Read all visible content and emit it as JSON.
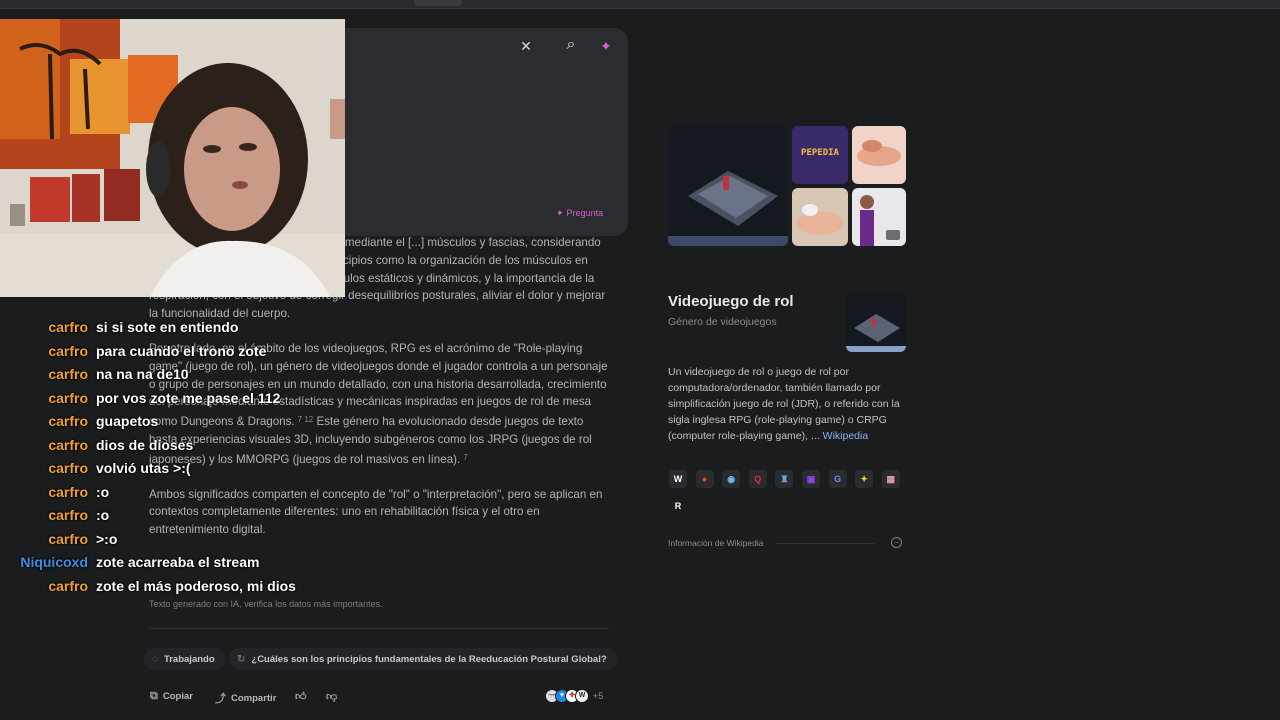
{
  "search_card": {
    "close_icon": "✕",
    "search_icon": "⌕",
    "ai_icon": "✦",
    "ask_label": "Pregunta"
  },
  "answer": {
    "p1": "[...] posturales y musculoesqueléticos mediante el [...] músculos y fascias, considerando al cuerpo [...] La RPG se basa en principios como la organización de los músculos en cadenas, la diferenciación entre músculos estáticos y dinámicos, y la importancia de la respiración, con el objetivo de corregir desequilibrios posturales, aliviar el dolor y mejorar la funcionalidad del cuerpo.",
    "p2a": "Por otro lado, en el ámbito de los videojuegos, RPG es el acrónimo de \"Role-playing game\" (juego de rol), un género de videojuegos donde el jugador controla a un personaje o grupo de personajes en un mundo detallado, con una historia desarrollada, crecimiento del personaje mediante estadísticas y mecánicas inspiradas en juegos de rol de mesa como Dungeons & Dragons.",
    "p2a_cite": "7 12",
    "p2b": "Este género ha evolucionado desde juegos de texto hasta experiencias visuales 3D, incluyendo subgéneros como los JRPG (juegos de rol japoneses) y los MMORPG (juegos de rol masivos en línea).",
    "p2b_cite": "7",
    "p3": "Ambos significados comparten el concepto de \"rol\" o \"interpretación\", pero se aplican en contextos completamente diferentes: uno en rehabilitación física y el otro en entretenimiento digital.",
    "disclaimer": "Texto generado con IA, verifica los datos más importantes."
  },
  "chips": {
    "working": "Trabajando",
    "suggestion": "¿Cuáles son los principios fundamentales de la Reeducación Postural Global?"
  },
  "actions": {
    "copy": "Copiar",
    "share": "Compartir",
    "sources_more": "+5"
  },
  "chat": [
    {
      "user": "carfro",
      "color": "#f0a030",
      "msg": "si si sote en entiendo"
    },
    {
      "user": "carfro",
      "color": "#f0a030",
      "msg": "para cuando el trono zote"
    },
    {
      "user": "carfro",
      "color": "#f0a030",
      "msg": "na na na de10"
    },
    {
      "user": "carfro",
      "color": "#f0a030",
      "msg": "por vos zote me pase el 112"
    },
    {
      "user": "carfro",
      "color": "#f0a030",
      "msg": "guapetos"
    },
    {
      "user": "carfro",
      "color": "#f0a030",
      "msg": "dios de dioses"
    },
    {
      "user": "carfro",
      "color": "#f0a030",
      "msg": "volvió utas >:("
    },
    {
      "user": "carfro",
      "color": "#f0a030",
      "msg": ":o"
    },
    {
      "user": "carfro",
      "color": "#f0a030",
      "msg": ":o"
    },
    {
      "user": "carfro",
      "color": "#f0a030",
      "msg": ">:o"
    },
    {
      "user": "Niquicoxd",
      "color": "#3f8fe0",
      "msg": "zote acarreaba el stream"
    },
    {
      "user": "carfro",
      "color": "#f0a030",
      "msg": "zote el más poderoso, mi dios"
    }
  ],
  "knowledge_panel": {
    "title": "Videojuego de rol",
    "subtitle": "Género de videojuegos",
    "description": "Un videojuego de rol o juego de rol por computadora/ordenador, también llamado por simplificación juego de rol (JDR), o referido con la sigla inglesa RPG (role-playing game) o CRPG (computer role-playing game), ...",
    "wiki_link": "Wikipedia",
    "pepedia_text": "PEPEDIA",
    "footer": "Información de Wikipedia",
    "socials": [
      {
        "name": "wikipedia-icon",
        "glyph": "W",
        "color": "#ffffff",
        "bg": "#2a2b2f"
      },
      {
        "name": "reddit-icon",
        "glyph": "●",
        "color": "#ff4500",
        "bg": "#2a2b2f"
      },
      {
        "name": "steam-icon",
        "glyph": "◉",
        "color": "#66c0f4",
        "bg": "#2a2b2f"
      },
      {
        "name": "rpg-icon",
        "glyph": "Q",
        "color": "#e03030",
        "bg": "#2a2b2f"
      },
      {
        "name": "fandom-icon",
        "glyph": "♜",
        "color": "#6aa6d8",
        "bg": "#2a2b2f"
      },
      {
        "name": "twitch-icon",
        "glyph": "▣",
        "color": "#9146ff",
        "bg": "#2a2b2f"
      },
      {
        "name": "gamespot-icon",
        "glyph": "G",
        "color": "#6d8cff",
        "bg": "#2a2b2f"
      },
      {
        "name": "star-icon",
        "glyph": "✦",
        "color": "#f0d020",
        "bg": "#2a2b2f"
      },
      {
        "name": "site-icon",
        "glyph": "▦",
        "color": "#e0a0a0",
        "bg": "#2a2b2f"
      },
      {
        "name": "r-icon",
        "glyph": "R",
        "color": "#ffffff",
        "bg": "#1b1c1e"
      }
    ]
  }
}
